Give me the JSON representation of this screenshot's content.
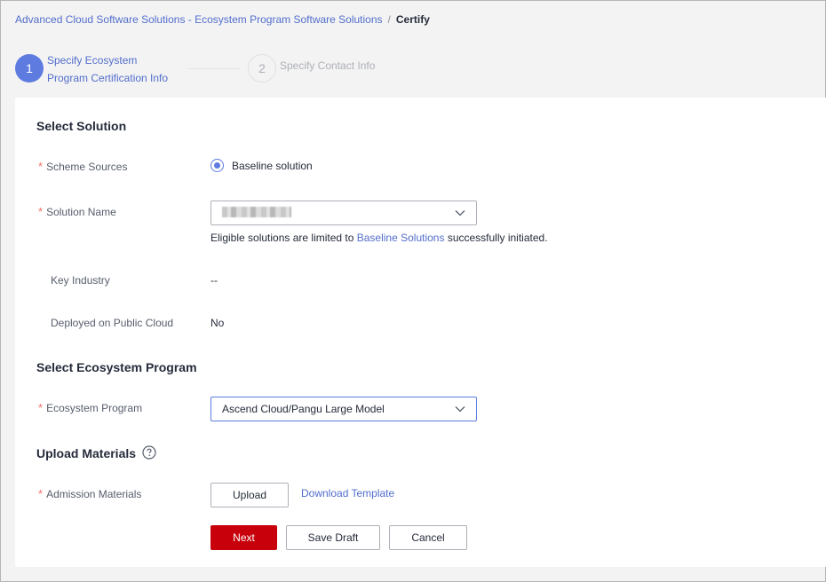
{
  "breadcrumb": {
    "parent": "Advanced Cloud Software Solutions - Ecosystem Program Software Solutions",
    "separator": "/",
    "current": "Certify"
  },
  "steps": [
    {
      "number": "1",
      "label_line1": "Specify Ecosystem",
      "label_line2": "Program Certification Info",
      "status": "active"
    },
    {
      "number": "2",
      "label": "Specify Contact Info",
      "status": "pending"
    }
  ],
  "select_solution": {
    "title": "Select Solution",
    "scheme_sources": {
      "label": "Scheme Sources",
      "required": "*",
      "option": "Baseline solution",
      "selected": true
    },
    "solution_name": {
      "label": "Solution Name",
      "required": "*",
      "hint_prefix": "Eligible solutions are limited to ",
      "hint_link": "Baseline Solutions",
      "hint_suffix": " successfully initiated."
    },
    "key_industry": {
      "label": "Key Industry",
      "value": "--"
    },
    "public_cloud": {
      "label": "Deployed on Public Cloud",
      "value": "No"
    }
  },
  "ecosystem_program": {
    "title": "Select Ecosystem Program",
    "field": {
      "label": "Ecosystem Program",
      "required": "*",
      "value": "Ascend Cloud/Pangu Large Model"
    }
  },
  "upload_materials": {
    "title": "Upload Materials",
    "help_icon": "question-circle-icon",
    "field": {
      "label": "Admission Materials",
      "required": "*",
      "upload_label": "Upload",
      "download_label": "Download Template"
    }
  },
  "actions": {
    "next": "Next",
    "save_draft": "Save Draft",
    "cancel": "Cancel"
  },
  "colors": {
    "primary": "#5e7ce0",
    "link": "#526ecc",
    "danger": "#c7000b",
    "required": "#f66f6a"
  }
}
